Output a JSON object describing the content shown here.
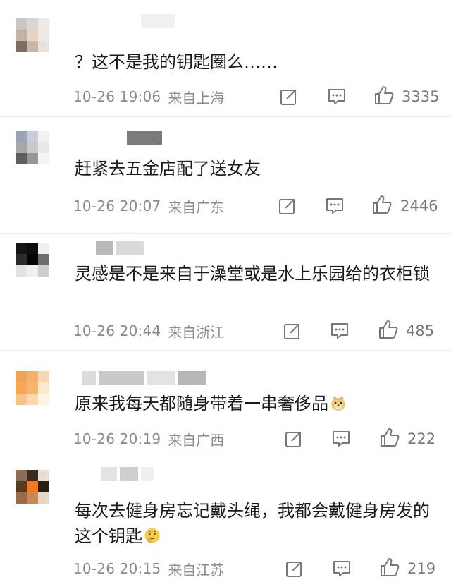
{
  "colors": {
    "text": "#1a1a1a",
    "meta": "#8a8a8a",
    "divider": "#ececec"
  },
  "icons": {
    "share": "share-icon",
    "comment": "comment-icon",
    "like": "thumbs-up-icon"
  },
  "comments": [
    {
      "text": "？这不是我的钥匙圈么……",
      "time": "10-26 19:06",
      "location": "来自上海",
      "likes": "3335"
    },
    {
      "text": "赶紧去五金店配了送女友",
      "time": "10-26 20:07",
      "location": "来自广东",
      "likes": "2446"
    },
    {
      "text": "灵感是不是来自于澡堂或是水上乐园给的衣柜锁",
      "time": "10-26 20:44",
      "location": "来自浙江",
      "likes": "485"
    },
    {
      "text": "原来我每天都随身带着一串奢侈品",
      "emoji": "doge-emoji-icon",
      "time": "10-26 20:19",
      "location": "来自广西",
      "likes": "222"
    },
    {
      "text": "每次去健身房忘记戴头绳，我都会戴健身房发的这个钥匙",
      "emoji": "thinking-emoji-icon",
      "time": "10-26 20:15",
      "location": "来自江苏",
      "likes": "219"
    }
  ]
}
